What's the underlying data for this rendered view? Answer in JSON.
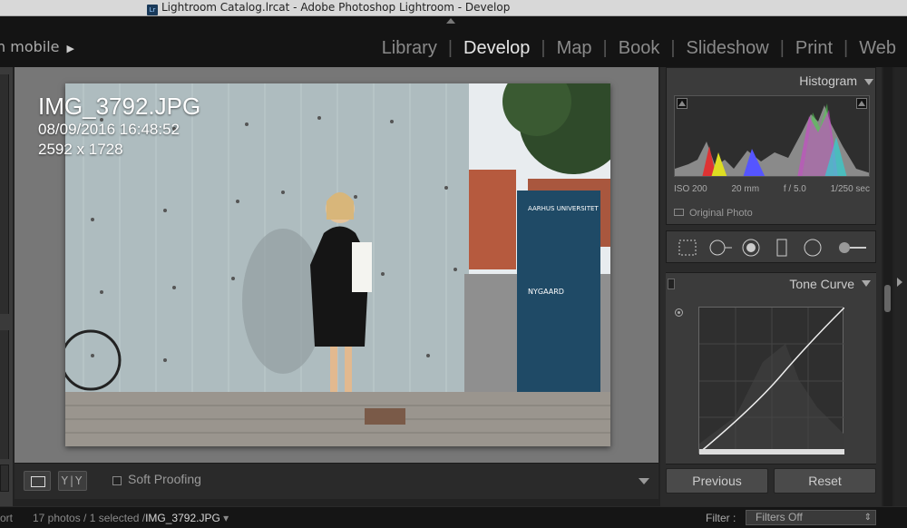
{
  "window": {
    "title": "Lightroom Catalog.lrcat - Adobe Photoshop Lightroom - Develop",
    "app_badge": "Lr"
  },
  "module_bar": {
    "identity_text": "n mobile",
    "modules": [
      {
        "label": "Library",
        "active": false
      },
      {
        "label": "Develop",
        "active": true
      },
      {
        "label": "Map",
        "active": false
      },
      {
        "label": "Book",
        "active": false
      },
      {
        "label": "Slideshow",
        "active": false
      },
      {
        "label": "Print",
        "active": false
      },
      {
        "label": "Web",
        "active": false
      }
    ]
  },
  "photo_info": {
    "filename": "IMG_3792.JPG",
    "datetime": "08/09/2016 16:48:52",
    "dimensions": "2592 x 1728"
  },
  "toolbar": {
    "view_compare_label": "Y|Y",
    "soft_proofing_label": "Soft Proofing",
    "soft_proofing_checked": false
  },
  "right_panel": {
    "histogram": {
      "title": "Histogram",
      "iso": "ISO 200",
      "focal": "20 mm",
      "aperture": "f / 5.0",
      "shutter": "1/250 sec",
      "original_photo_label": "Original Photo"
    },
    "tone_curve": {
      "title": "Tone Curve"
    },
    "buttons": {
      "previous": "Previous",
      "reset": "Reset"
    }
  },
  "status_bar": {
    "left_cut": "ort",
    "photos_count": "17 photos / 1 selected /",
    "selected_file": "IMG_3792.JPG",
    "filter_label": "Filter :",
    "filter_value": "Filters Off"
  },
  "colors": {
    "accent_text": "#e6e6e6",
    "panel_bg": "#3b3b3b",
    "canvas_bg": "#777777"
  }
}
